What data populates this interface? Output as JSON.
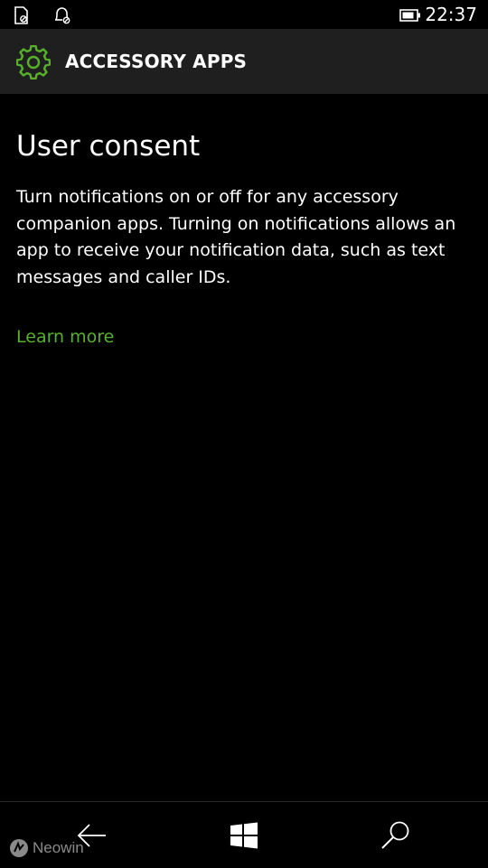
{
  "status_bar": {
    "left_icons": [
      "sim-missing-icon",
      "notification-blocked-icon"
    ],
    "battery_icon": "battery-icon",
    "time": "22:37"
  },
  "header": {
    "icon": "gear-icon",
    "title": "ACCESSORY APPS"
  },
  "main": {
    "heading": "User consent",
    "description": "Turn notifications on or off for any accessory companion apps. Turning on notifications allows an app to receive your notification data, such as text messages and caller IDs.",
    "learn_more_label": "Learn more"
  },
  "nav_bar": {
    "buttons": [
      "back-arrow-icon",
      "windows-start-icon",
      "search-icon"
    ]
  },
  "watermark": {
    "text": "Neowin"
  },
  "colors": {
    "accent": "#57b12a",
    "header_bg": "#1f1f1f",
    "background": "#000000",
    "text": "#ffffff"
  }
}
